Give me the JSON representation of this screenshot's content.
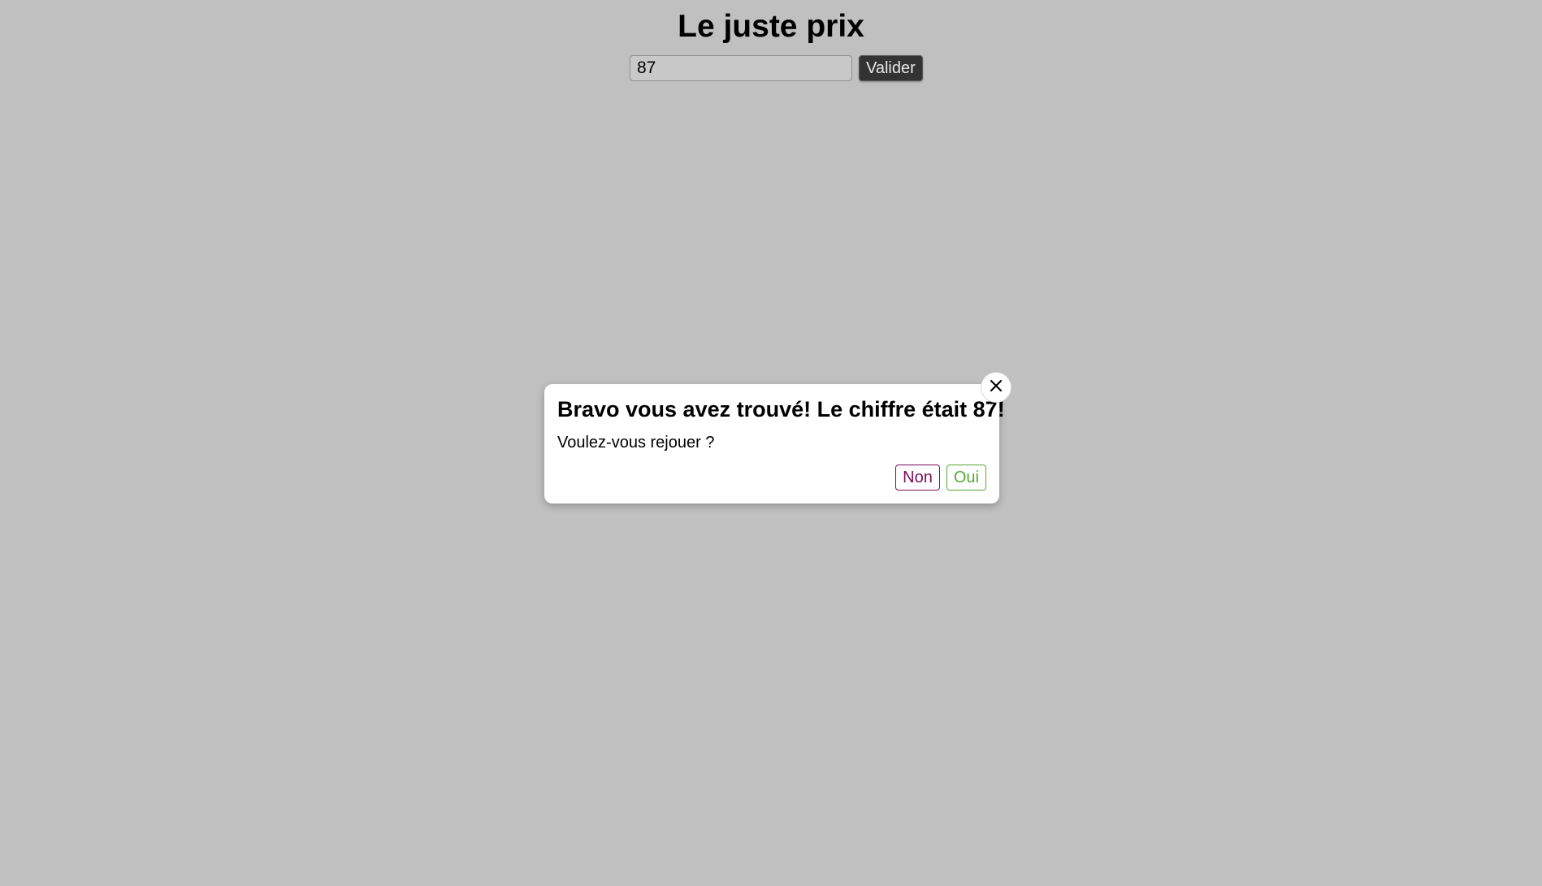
{
  "page": {
    "title": "Le juste prix"
  },
  "form": {
    "input_value": "87",
    "submit_label": "Valider"
  },
  "modal": {
    "title": "Bravo vous avez trouvé! Le chiffre était 87!",
    "message": "Voulez-vous rejouer ?",
    "no_label": "Non",
    "yes_label": "Oui",
    "close_icon": "close-icon"
  },
  "colors": {
    "background": "#c0c0c0",
    "submit_bg": "#333333",
    "no_color": "#7a0a5a",
    "yes_color": "#55a832"
  }
}
